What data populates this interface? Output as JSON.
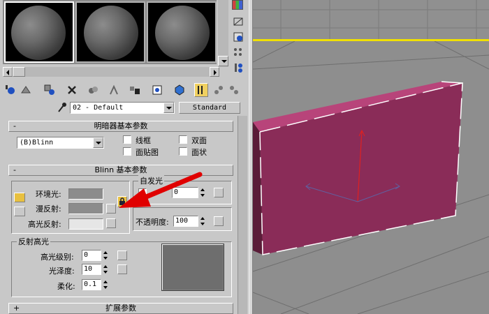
{
  "material": {
    "name": "02 - Default",
    "type_button": "Standard"
  },
  "shader_rollout": {
    "title": "明暗器基本参数",
    "shader": "(B)Blinn",
    "checkboxes": {
      "wire": "线框",
      "two_sided": "双面",
      "face_map": "面贴图",
      "faceted": "面状"
    }
  },
  "blinn_rollout": {
    "title": "Blinn 基本参数",
    "ambient_label": "环境光:",
    "diffuse_label": "漫反射:",
    "specular_label": "高光反射:",
    "self_illum_group": "自发光",
    "self_illum_value": "0",
    "opacity_label": "不透明度:",
    "opacity_value": "100",
    "ambient_color": "#8c8c8c",
    "diffuse_color": "#8c8c8c",
    "specular_color": "#e6e6e6"
  },
  "specular_highlights": {
    "group": "反射高光",
    "level_label": "高光级别:",
    "level_value": "0",
    "gloss_label": "光泽度:",
    "gloss_value": "10",
    "soften_label": "柔化:",
    "soften_value": "0.1",
    "preview_color": "#6e6e6e"
  },
  "extended_rollout": {
    "title": "扩展参数",
    "sign": "+"
  },
  "rollout_signs": {
    "shader": "-",
    "blinn": "-"
  },
  "viewport": {
    "background": "#8e8e8e",
    "object_color": "#9a2e63",
    "object_face_color": "#7d2850"
  },
  "annotation": {
    "arrow_color": "#e00000"
  },
  "icons": [
    "sphere-icon",
    "cylinder-icon",
    "background-icon",
    "options-icon",
    "sample-uv-icon",
    "get-material-icon",
    "assign-material-icon",
    "put-to-scene-icon",
    "reset-icon",
    "make-unique-icon",
    "put-to-library-icon",
    "material-effects-icon",
    "show-map-icon",
    "show-end-result-icon",
    "go-parent-icon",
    "go-sibling-icon",
    "pick-material-icon",
    "lock-icon"
  ]
}
